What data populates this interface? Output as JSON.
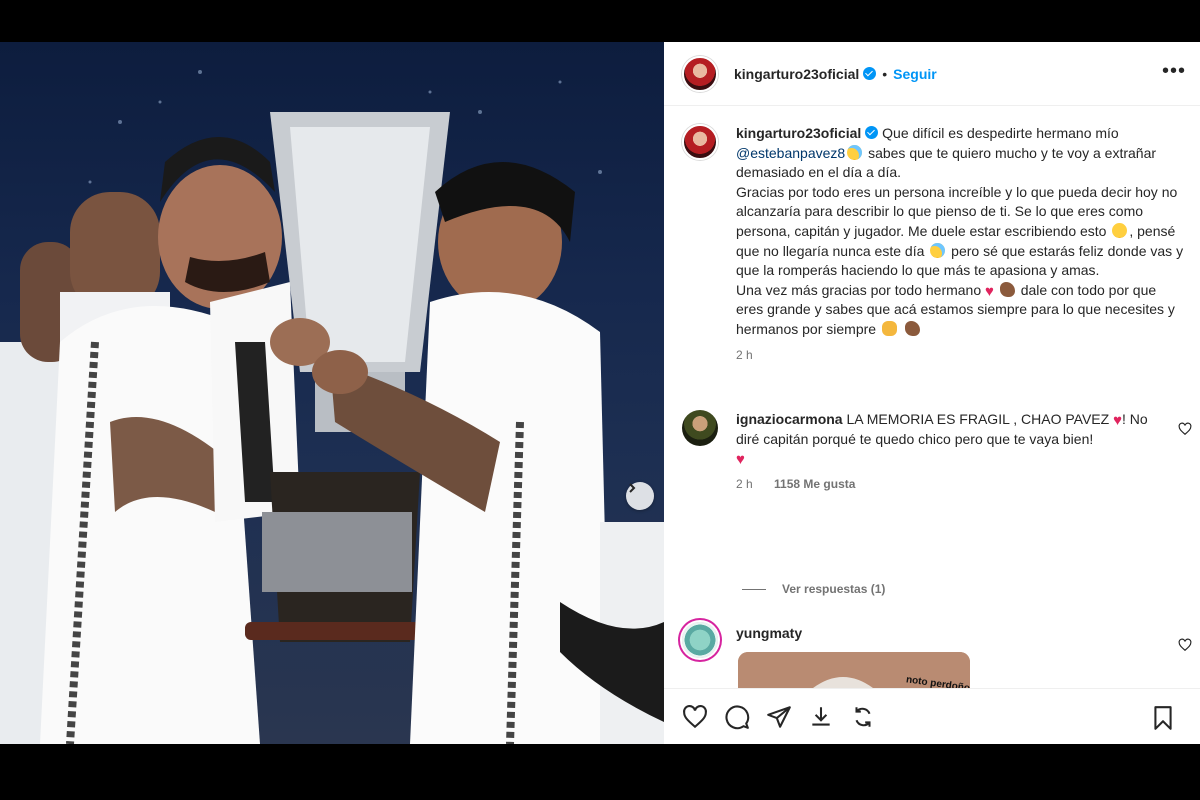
{
  "post": {
    "username": "kingarturo23oficial",
    "follow_label": "Seguir",
    "more_label": "•••",
    "caption_lines": [
      "Que difícil es despedirte hermano mío",
      "@estebanpavez8",
      " sabes que te quiero mucho y te voy a extrañar demasiado en el día a día.",
      "Gracias por todo eres un persona increíble y lo que pueda decir hoy no alcanzaría para describir lo que pienso de ti. Se lo que eres como persona, capitán y jugador. Me duele estar escribiendo esto",
      ", pensé que no llegaría nunca este día",
      "pero sé que estarás feliz donde vas y que la romperás haciendo lo que más te apasiona y amas.",
      "Una vez más gracias por todo hermano",
      "dale con todo por que eres grande y sabes que acá estamos siempre para lo que necesites y hermanos por siempre"
    ],
    "caption_time": "2 h"
  },
  "comments": [
    {
      "username": "ignaziocarmona",
      "text_1": "LA MEMORIA ES FRAGIL , CHAO PAVEZ",
      "text_2": "!",
      "text_3": "No diré capitán porqué te quedo chico pero que te vaya bien!",
      "time": "2 h",
      "likes": "1158 Me gusta",
      "view_replies": "Ver respuestas (1)"
    },
    {
      "username": "yungmaty",
      "gif_caption": "noto perdoño"
    }
  ],
  "icons": {
    "like": "heart-icon",
    "comment": "comment-icon",
    "share": "paper-plane-icon",
    "download": "download-icon",
    "repost": "repost-icon",
    "save": "bookmark-icon"
  },
  "colors": {
    "accent": "#0095f6",
    "mention": "#00376b",
    "heart": "#e0245e"
  }
}
